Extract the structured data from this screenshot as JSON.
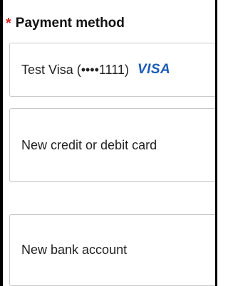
{
  "header": {
    "required_marker": "*",
    "title": "Payment method"
  },
  "options": [
    {
      "label": "Test Visa (••••1111)",
      "brand": "VISA"
    },
    {
      "label": "New credit or debit card"
    },
    {
      "label": "New bank account"
    }
  ],
  "colors": {
    "required_marker": "#d92b2b",
    "visa_brand": "#1a5bb8",
    "option_border": "#c9c9c9"
  }
}
